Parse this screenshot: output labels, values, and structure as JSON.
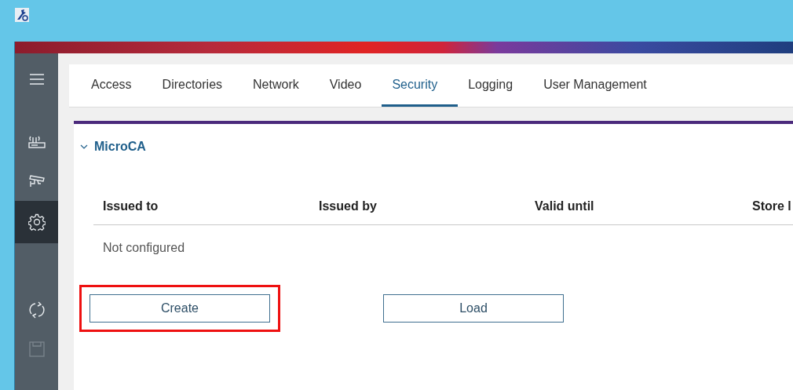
{
  "sidebar": {
    "items": [
      {
        "kind": "menu",
        "selected": false,
        "disabled": false
      },
      {
        "kind": "router",
        "selected": false,
        "disabled": false
      },
      {
        "kind": "camera",
        "selected": false,
        "disabled": false
      },
      {
        "kind": "settings",
        "selected": true,
        "disabled": false
      },
      {
        "kind": "refresh",
        "selected": false,
        "disabled": false
      },
      {
        "kind": "save",
        "selected": false,
        "disabled": true
      }
    ]
  },
  "tabs": [
    {
      "label": "Access",
      "selected": false
    },
    {
      "label": "Directories",
      "selected": false
    },
    {
      "label": "Network",
      "selected": false
    },
    {
      "label": "Video",
      "selected": false
    },
    {
      "label": "Security",
      "selected": true
    },
    {
      "label": "Logging",
      "selected": false
    },
    {
      "label": "User Management",
      "selected": false
    }
  ],
  "section": {
    "title": "MicroCA",
    "expanded": true,
    "table": {
      "columns": [
        "Issued to",
        "Issued by",
        "Valid until",
        "Store l"
      ],
      "empty_text": "Not configured"
    },
    "buttons": [
      {
        "label": "Create",
        "highlighted": true
      },
      {
        "label": "Load",
        "highlighted": false
      }
    ]
  }
}
